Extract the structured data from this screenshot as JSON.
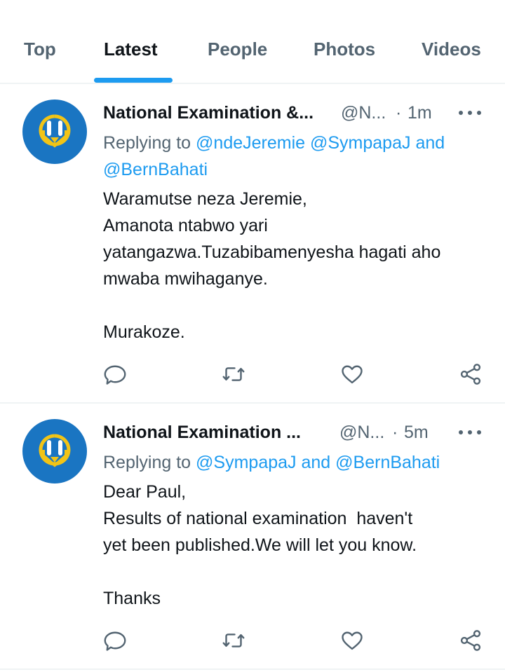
{
  "tabs": [
    {
      "label": "Top",
      "active": false
    },
    {
      "label": "Latest",
      "active": true
    },
    {
      "label": "People",
      "active": false
    },
    {
      "label": "Photos",
      "active": false
    },
    {
      "label": "Videos",
      "active": false
    }
  ],
  "colors": {
    "accent": "#1d9bf0",
    "text": "#0f1419",
    "muted": "#536471",
    "avatar_bg": "#1a75c2",
    "avatar_logo": "#f2c416"
  },
  "tweets": [
    {
      "avatar_icon": "nesa-logo-icon",
      "name": "National Examination &...",
      "handle": "@N...",
      "separator": "·",
      "time": "1m",
      "replying_prefix": "Replying to ",
      "mention_1": "@ndeJeremie",
      "mention_2": "@SympapaJ",
      "and_word": "and",
      "mention_3": "@BernBahati",
      "body": "Waramutse neza Jeremie,\nAmanota ntabwo yari\nyatangazwa.Tuzabibamenyesha hagati aho\nmwaba mwihaganye.\n\nMurakoze."
    },
    {
      "avatar_icon": "nesa-logo-icon",
      "name": "National Examination ...",
      "handle": "@N...",
      "separator": "·",
      "time": "5m",
      "replying_prefix": "Replying to ",
      "mention_1": "@SympapaJ",
      "and_word": "and",
      "mention_2": "@BernBahati",
      "body": "Dear Paul,\nResults of national examination  haven't\nyet been published.We will let you know.\n\nThanks"
    }
  ]
}
